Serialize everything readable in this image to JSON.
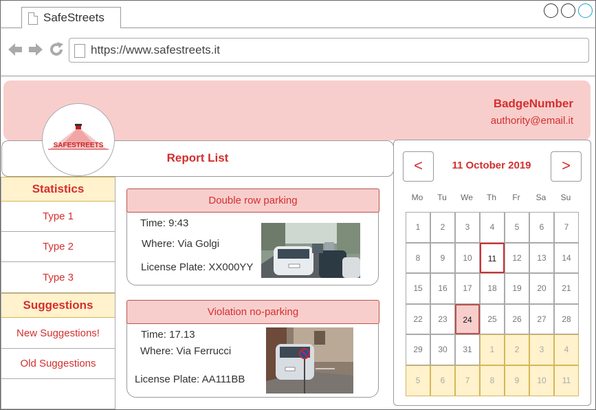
{
  "browser": {
    "tab_title": "SafeStreets",
    "url": "https://www.safestreets.it"
  },
  "header": {
    "badge_number": "BadgeNumber",
    "email": "authority@email.it",
    "logo_text": "SAFESTREETS"
  },
  "report_list_title": "Report List",
  "sidebar": {
    "statistics_heading": "Statistics",
    "types": [
      "Type 1",
      "Type 2",
      "Type 3"
    ],
    "suggestions_heading": "Suggestions",
    "suggestion_items": [
      "New Suggestions!",
      "Old Suggestions"
    ]
  },
  "reports": [
    {
      "title": "Double row parking",
      "time": "Time: 9:43",
      "where": "Where: Via Golgi",
      "plate": "License Plate: XX000YY"
    },
    {
      "title": "Violation no-parking",
      "time": "Time: 17.13",
      "where": "Where: Via Ferrucci",
      "plate": "License Plate:  AA111BB"
    }
  ],
  "calendar": {
    "prev": "<",
    "next": ">",
    "month_label": "11 October 2019",
    "weekdays": [
      "Mo",
      "Tu",
      "We",
      "Th",
      "Fr",
      "Sa",
      "Su"
    ],
    "weeks": [
      [
        "1",
        "2",
        "3",
        "4",
        "5",
        "6",
        "7"
      ],
      [
        "8",
        "9",
        "10",
        "11",
        "12",
        "13",
        "14"
      ],
      [
        "15",
        "16",
        "17",
        "18",
        "19",
        "20",
        "21"
      ],
      [
        "22",
        "23",
        "24",
        "25",
        "26",
        "27",
        "28"
      ],
      [
        "29",
        "30",
        "31",
        "1",
        "2",
        "3",
        "4"
      ],
      [
        "5",
        "6",
        "7",
        "8",
        "9",
        "10",
        "11"
      ]
    ],
    "today": "11",
    "selected": "24"
  },
  "colors": {
    "accent": "#d32f2f",
    "header_bg": "#f8cecc",
    "sidebar_heading_bg": "#fff2cc",
    "next_month_bg": "#fff2cc"
  }
}
